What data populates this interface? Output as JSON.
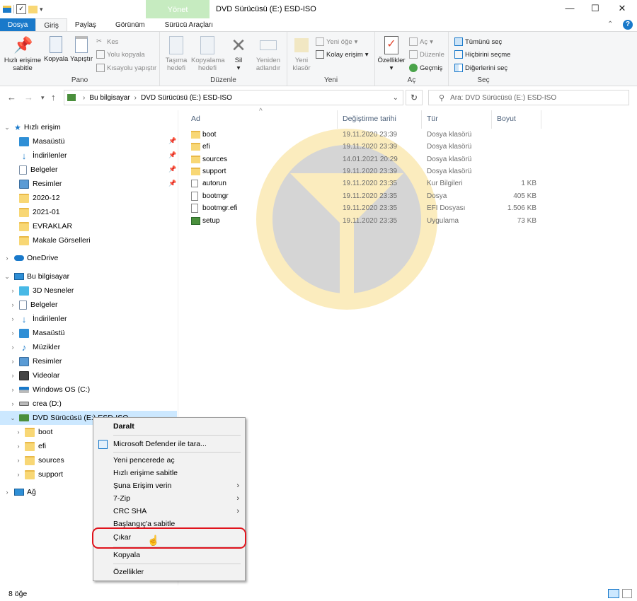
{
  "window": {
    "contextual_tab_label": "Yönet",
    "title": "DVD Sürücüsü (E:) ESD-ISO",
    "controls": [
      "—",
      "☐",
      "✕"
    ]
  },
  "ribbon_tabs": [
    "Dosya",
    "Giriş",
    "Paylaş",
    "Görünüm",
    "Sürücü Araçları"
  ],
  "ribbon": {
    "pano": {
      "label": "Pano",
      "pin_quick": "Hızlı erişime\nsabitle",
      "copy": "Kopyala",
      "paste": "Yapıştır",
      "cut": "Kes",
      "copy_path": "Yolu kopyala",
      "paste_shortcut": "Kısayolu yapıştır"
    },
    "duzenle": {
      "label": "Düzenle",
      "move_to": "Taşıma\nhedefi",
      "copy_to": "Kopyalama\nhedefi",
      "delete": "Sil",
      "rename": "Yeniden\nadlandır"
    },
    "yeni": {
      "label": "Yeni",
      "new_folder": "Yeni\nklasör",
      "new_item": "Yeni öğe",
      "easy_access": "Kolay erişim"
    },
    "ac": {
      "label": "Aç",
      "properties": "Özellikler",
      "open": "Aç",
      "edit": "Düzenle",
      "history": "Geçmiş"
    },
    "sec": {
      "label": "Seç",
      "select_all": "Tümünü seç",
      "select_none": "Hiçbirini seçme",
      "invert": "Diğerlerini seç"
    }
  },
  "address": {
    "crumbs": [
      "Bu bilgisayar",
      "DVD Sürücüsü (E:) ESD-ISO"
    ],
    "search_placeholder": "Ara: DVD Sürücüsü (E:) ESD-ISO"
  },
  "nav": {
    "quick_access": "Hızlı erişim",
    "quick_items": [
      "Masaüstü",
      "İndirilenler",
      "Belgeler",
      "Resimler",
      "2020-12",
      "2021-01",
      "EVRAKLAR",
      "Makale Görselleri"
    ],
    "onedrive": "OneDrive",
    "this_pc": "Bu bilgisayar",
    "pc_items": [
      "3D Nesneler",
      "Belgeler",
      "İndirilenler",
      "Masaüstü",
      "Müzikler",
      "Resimler",
      "Videolar",
      "Windows OS (C:)",
      "crea (D:)",
      "DVD Sürücüsü (E:) ESD-ISO"
    ],
    "dvd_children": [
      "boot",
      "efi",
      "sources",
      "support"
    ],
    "network": "Ağ"
  },
  "columns": [
    "Ad",
    "Değiştirme tarihi",
    "Tür",
    "Boyut"
  ],
  "files": [
    {
      "name": "boot",
      "date": "19.11.2020 23:39",
      "type": "Dosya klasörü",
      "size": "",
      "icon": "folder"
    },
    {
      "name": "efi",
      "date": "19.11.2020 23:39",
      "type": "Dosya klasörü",
      "size": "",
      "icon": "folder"
    },
    {
      "name": "sources",
      "date": "14.01.2021 20:29",
      "type": "Dosya klasörü",
      "size": "",
      "icon": "folder"
    },
    {
      "name": "support",
      "date": "19.11.2020 23:39",
      "type": "Dosya klasörü",
      "size": "",
      "icon": "folder"
    },
    {
      "name": "autorun",
      "date": "19.11.2020 23:35",
      "type": "Kur Bilgileri",
      "size": "1 KB",
      "icon": "gear"
    },
    {
      "name": "bootmgr",
      "date": "19.11.2020 23:35",
      "type": "Dosya",
      "size": "405 KB",
      "icon": "doc"
    },
    {
      "name": "bootmgr.efi",
      "date": "19.11.2020 23:35",
      "type": "EFI Dosyası",
      "size": "1.506 KB",
      "icon": "doc"
    },
    {
      "name": "setup",
      "date": "19.11.2020 23:35",
      "type": "Uygulama",
      "size": "73 KB",
      "icon": "setup"
    }
  ],
  "context_menu": {
    "collapse": "Daralt",
    "defender": "Microsoft Defender ile tara...",
    "open_new_window": "Yeni pencerede aç",
    "pin_quick": "Hızlı erişime sabitle",
    "give_access": "Şuna Erişim verin",
    "zip": "7-Zip",
    "crc": "CRC SHA",
    "pin_start": "Başlangıç'a sabitle",
    "eject": "Çıkar",
    "copy": "Kopyala",
    "properties": "Özellikler"
  },
  "status": {
    "item_count": "8 öğe"
  }
}
